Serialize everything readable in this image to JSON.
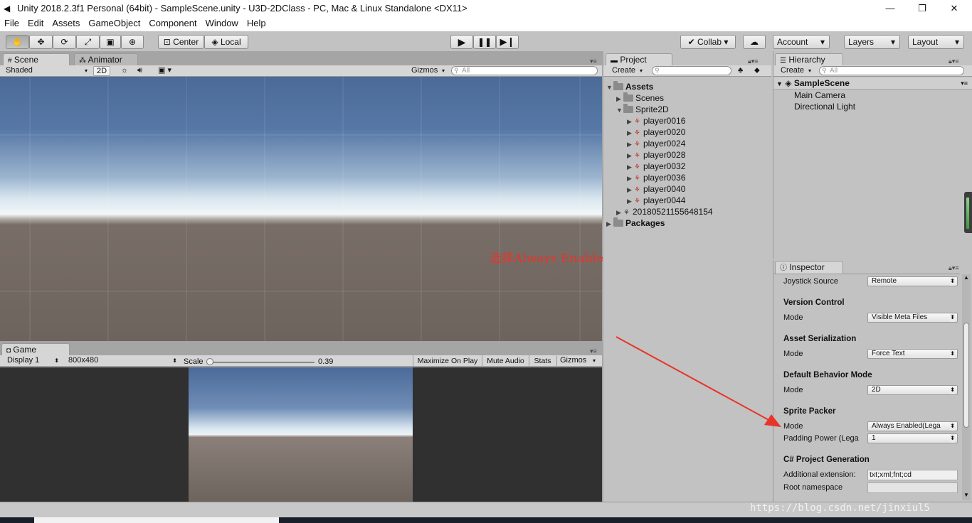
{
  "window": {
    "title": "Unity 2018.2.3f1 Personal (64bit) - SampleScene.unity - U3D-2DClass - PC, Mac & Linux Standalone <DX11>"
  },
  "menu": [
    "File",
    "Edit",
    "Assets",
    "GameObject",
    "Component",
    "Window",
    "Help"
  ],
  "toolbar": {
    "tools": [
      "hand-tool-icon",
      "move-tool-icon",
      "rotate-tool-icon",
      "scale-tool-icon",
      "rect-tool-icon",
      "transform-tool-icon"
    ],
    "pivot": "Center",
    "space": "Local",
    "collab": "Collab",
    "account": "Account",
    "layers": "Layers",
    "layout": "Layout"
  },
  "scene": {
    "tab": "Scene",
    "tab2": "Animator",
    "shading": "Shaded",
    "mode2d": "2D",
    "gizmos": "Gizmos",
    "search_placeholder": "All"
  },
  "game": {
    "tab": "Game",
    "display": "Display 1",
    "resolution": "800x480",
    "scale_label": "Scale",
    "scale_value": "0.39",
    "maximize": "Maximize On Play",
    "mute": "Mute Audio",
    "stats": "Stats",
    "gizmos": "Gizmos"
  },
  "project": {
    "tab": "Project",
    "create": "Create",
    "tree": {
      "assets": "Assets",
      "scenes": "Scenes",
      "sprite2d": "Sprite2D",
      "players": [
        "player0016",
        "player0020",
        "player0024",
        "player0028",
        "player0032",
        "player0036",
        "player0040",
        "player0044"
      ],
      "sheet": "20180521155648154",
      "packages": "Packages"
    }
  },
  "hierarchy": {
    "tab": "Hierarchy",
    "create": "Create",
    "search_placeholder": "All",
    "scene_name": "SampleScene",
    "items": [
      "Main Camera",
      "Directional Light"
    ]
  },
  "inspector": {
    "tab": "Inspector",
    "joystick_label": "Joystick Source",
    "joystick_value": "Remote",
    "vc_head": "Version Control",
    "vc_mode_label": "Mode",
    "vc_mode_value": "Visible Meta Files",
    "as_head": "Asset Serialization",
    "as_mode_label": "Mode",
    "as_mode_value": "Force Text",
    "db_head": "Default Behavior Mode",
    "db_mode_label": "Mode",
    "db_mode_value": "2D",
    "sp_head": "Sprite Packer",
    "sp_mode_label": "Mode",
    "sp_mode_value": "Always Enabled(Lega",
    "sp_padding_label": "Padding Power (Lega",
    "sp_padding_value": "1",
    "cs_head": "C# Project Generation",
    "cs_ext_label": "Additional extension:",
    "cs_ext_value": "txt;xml;fnt;cd",
    "cs_ns_label": "Root namespace",
    "cs_ns_value": ""
  },
  "annotation": {
    "text": "选择Always Enabled 模式",
    "color": "#e8342a"
  },
  "watermark": "https://blog.csdn.net/jinxiul5"
}
